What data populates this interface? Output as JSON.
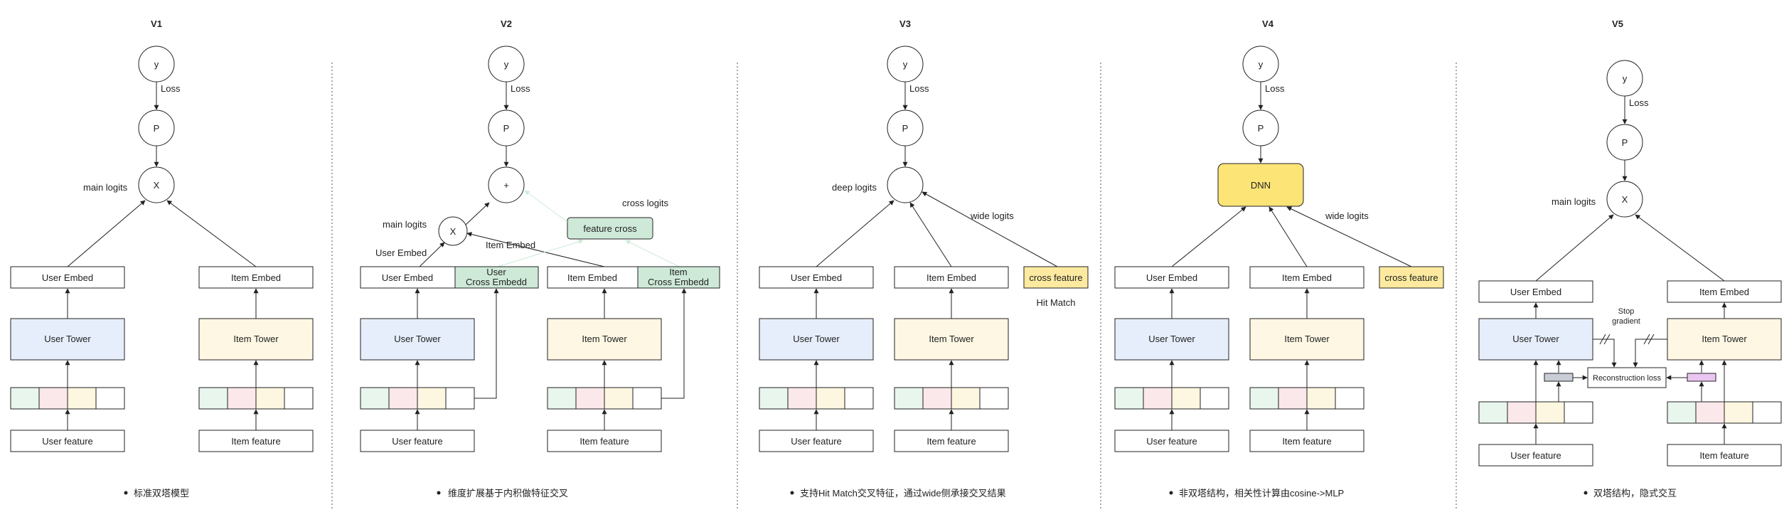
{
  "colors": {
    "user_tower": "#e6eefb",
    "item_tower": "#fdf7e4",
    "feat_green": "#e8f6ee",
    "feat_pink": "#fbe8ea",
    "feat_yellow": "#fdf6e0",
    "cross_box": "#cfe9d8",
    "cross_feature": "#fdeaa0",
    "dnn": "#fde477",
    "gray_chip": "#c8cdd6",
    "purple_chip": "#ecc6f2"
  },
  "v1": {
    "title": "V1",
    "y": "y",
    "loss": "Loss",
    "p": "P",
    "x": "X",
    "main_logits": "main logits",
    "user_embed": "User Embed",
    "item_embed": "Item Embed",
    "user_tower": "User Tower",
    "item_tower": "Item Tower",
    "user_feature": "User feature",
    "item_feature": "Item feature",
    "caption": "标准双塔模型"
  },
  "v2": {
    "title": "V2",
    "y": "y",
    "loss": "Loss",
    "p": "P",
    "plus": "+",
    "x": "X",
    "main_logits": "main logits",
    "cross_logits": "cross logits",
    "feature_cross": "feature cross",
    "user_embed_arrow": "User Embed",
    "item_embed_arrow": "Item Embed",
    "user_embed": "User Embed",
    "item_embed": "Item Embed",
    "user_cross_1": "User",
    "user_cross_2": "Cross Embedd",
    "item_cross_1": "Item",
    "item_cross_2": "Cross Embedd",
    "user_tower": "User Tower",
    "item_tower": "Item Tower",
    "user_feature": "User feature",
    "item_feature": "Item feature",
    "caption": "维度扩展基于内积做特征交叉"
  },
  "v3": {
    "title": "V3",
    "y": "y",
    "loss": "Loss",
    "p": "P",
    "deep_logits": "deep logits",
    "wide_logits": "wide logits",
    "user_embed": "User Embed",
    "item_embed": "Item Embed",
    "cross_feature": "cross feature",
    "hit_match": "Hit Match",
    "user_tower": "User Tower",
    "item_tower": "Item Tower",
    "user_feature": "User feature",
    "item_feature": "Item feature",
    "caption": "支持Hit Match交叉特征，通过wide侧承接交叉结果"
  },
  "v4": {
    "title": "V4",
    "y": "y",
    "loss": "Loss",
    "p": "P",
    "dnn": "DNN",
    "wide_logits": "wide logits",
    "user_embed": "User Embed",
    "item_embed": "Item Embed",
    "cross_feature": "cross feature",
    "user_tower": "User Tower",
    "item_tower": "Item Tower",
    "user_feature": "User feature",
    "item_feature": "Item feature",
    "caption": "非双塔结构，相关性计算由cosine->MLP"
  },
  "v5": {
    "title": "V5",
    "y": "y",
    "loss": "Loss",
    "p": "P",
    "x": "X",
    "main_logits": "main logits",
    "user_embed": "User Embed",
    "item_embed": "Item Embed",
    "stop_1": "Stop",
    "stop_2": "gradient",
    "user_tower": "User Tower",
    "item_tower": "Item Tower",
    "recon_loss": "Reconstruction loss",
    "user_feature": "User feature",
    "item_feature": "Item feature",
    "caption": "双塔结构，隐式交互"
  }
}
